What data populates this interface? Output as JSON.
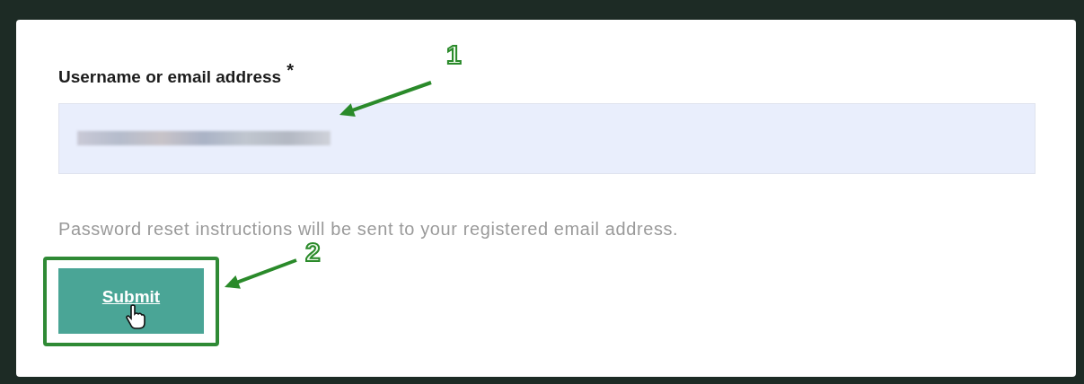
{
  "form": {
    "label": "Username or email address",
    "required_mark": "*",
    "help_text": "Password reset instructions will be sent to your registered email address.",
    "button": {
      "label": "Submit",
      "highlighted": true
    }
  },
  "annotations": [
    {
      "number": "1"
    },
    {
      "number": "2"
    }
  ]
}
